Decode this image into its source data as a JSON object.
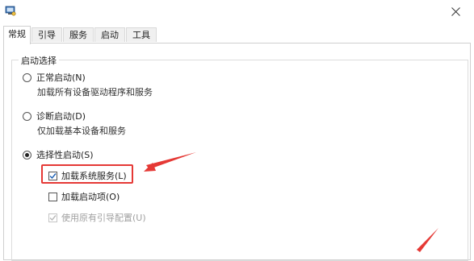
{
  "window": {
    "close_icon": "close-icon",
    "app_icon": "system-config-icon"
  },
  "tabs": [
    {
      "label": "常规",
      "active": true
    },
    {
      "label": "引导",
      "active": false
    },
    {
      "label": "服务",
      "active": false
    },
    {
      "label": "启动",
      "active": false
    },
    {
      "label": "工具",
      "active": false
    }
  ],
  "startup_selection": {
    "title": "启动选择",
    "options": [
      {
        "label": "正常启动(N)",
        "description": "加载所有设备驱动程序和服务",
        "selected": false
      },
      {
        "label": "诊断启动(D)",
        "description": "仅加载基本设备和服务",
        "selected": false
      },
      {
        "label": "选择性启动(S)",
        "selected": true
      }
    ],
    "selective_options": [
      {
        "label": "加载系统服务(L)",
        "checked": true,
        "enabled": true
      },
      {
        "label": "加载启动项(O)",
        "checked": false,
        "enabled": true
      },
      {
        "label": "使用原有引导配置(U)",
        "checked": true,
        "enabled": false
      }
    ]
  },
  "annotation": {
    "color": "#e53935"
  }
}
